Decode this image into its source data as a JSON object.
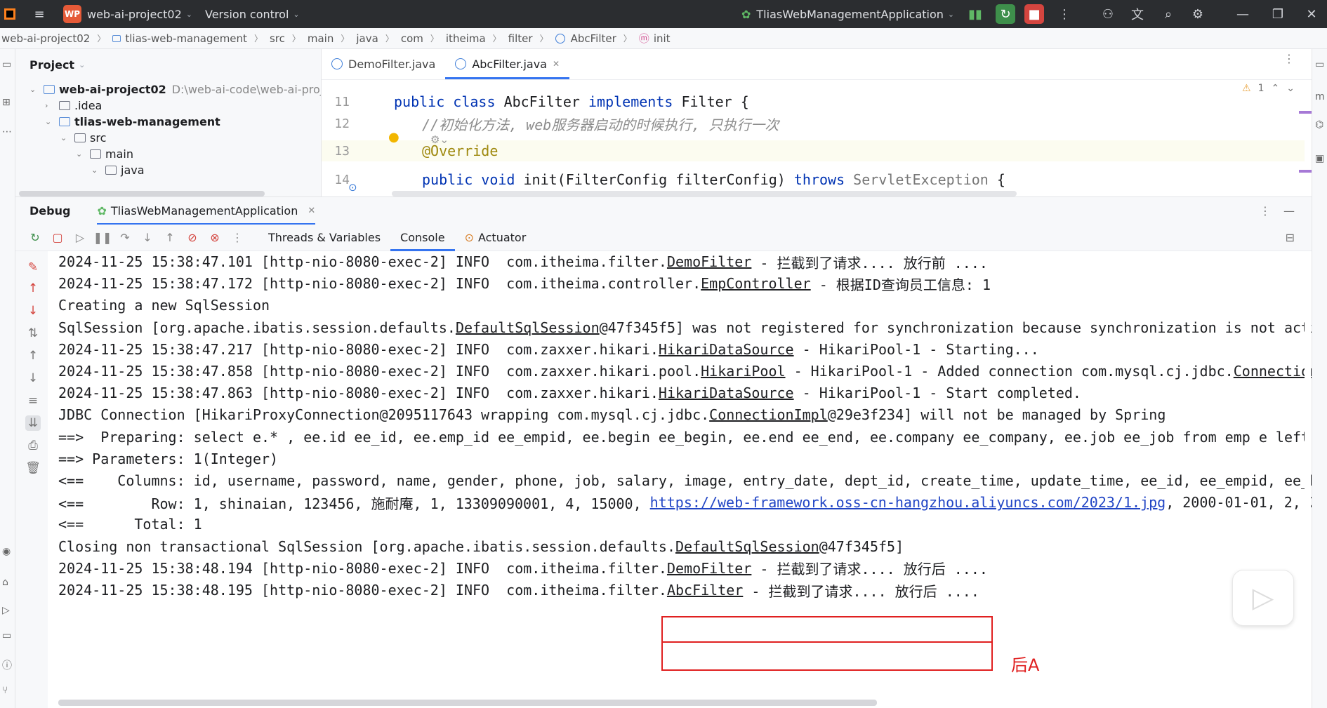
{
  "titlebar": {
    "project_badge": "WP",
    "project_name": "web-ai-project02",
    "version_control": "Version control",
    "run_config": "TliasWebManagementApplication"
  },
  "breadcrumbs": [
    "web-ai-project02",
    "tlias-web-management",
    "src",
    "main",
    "java",
    "com",
    "itheima",
    "filter",
    "AbcFilter",
    "init"
  ],
  "project_panel": {
    "title": "Project",
    "tree": [
      {
        "label": "web-ai-project02",
        "path": "D:\\web-ai-code\\web-ai-proj",
        "depth": 0,
        "expanded": true,
        "bold": true,
        "module": true
      },
      {
        "label": ".idea",
        "depth": 1,
        "expanded": false,
        "bold": false,
        "module": false
      },
      {
        "label": "tlias-web-management",
        "depth": 1,
        "expanded": true,
        "bold": true,
        "module": true
      },
      {
        "label": "src",
        "depth": 2,
        "expanded": true,
        "bold": false,
        "module": false
      },
      {
        "label": "main",
        "depth": 3,
        "expanded": true,
        "bold": false,
        "module": false
      },
      {
        "label": "java",
        "depth": 4,
        "expanded": true,
        "bold": false,
        "module": false
      }
    ]
  },
  "editor": {
    "tabs": [
      {
        "label": "DemoFilter.java",
        "active": false
      },
      {
        "label": "AbcFilter.java",
        "active": true
      }
    ],
    "warning_count": "1",
    "lines": [
      {
        "num": "11",
        "kind": "class_decl",
        "text": "public class AbcFilter implements Filter {"
      },
      {
        "num": "12",
        "kind": "comment",
        "text": "//初始化方法, web服务器启动的时候执行, 只执行一次"
      },
      {
        "num": "13",
        "kind": "annotation",
        "text": "@Override"
      },
      {
        "num": "14",
        "kind": "method_decl",
        "text": "public void init(FilterConfig filterConfig) throws ServletException {"
      }
    ]
  },
  "debug": {
    "title": "Debug",
    "session_tab": "TliasWebManagementApplication",
    "tabs": [
      {
        "label": "Threads & Variables",
        "active": false
      },
      {
        "label": "Console",
        "active": true
      },
      {
        "label": "Actuator",
        "active": false
      }
    ],
    "console_lines": [
      [
        {
          "t": "2024-11-25 15:38:47.101 [http-nio-8080-exec-2] INFO  com.itheima.filter."
        },
        {
          "t": "DemoFilter",
          "s": "u"
        },
        {
          "t": " - 拦截到了请求.... 放行前 ...."
        }
      ],
      [
        {
          "t": "2024-11-25 15:38:47.172 [http-nio-8080-exec-2] INFO  com.itheima.controller."
        },
        {
          "t": "EmpController",
          "s": "u"
        },
        {
          "t": " - 根据ID查询员工信息: 1"
        }
      ],
      [
        {
          "t": "Creating a new SqlSession"
        }
      ],
      [
        {
          "t": "SqlSession [org.apache.ibatis.session.defaults."
        },
        {
          "t": "DefaultSqlSession",
          "s": "u"
        },
        {
          "t": "@47f345f5] was not registered for synchronization because synchronization is not acti"
        }
      ],
      [
        {
          "t": "2024-11-25 15:38:47.217 [http-nio-8080-exec-2] INFO  com.zaxxer.hikari."
        },
        {
          "t": "HikariDataSource",
          "s": "u"
        },
        {
          "t": " - HikariPool-1 - Starting..."
        }
      ],
      [
        {
          "t": "2024-11-25 15:38:47.858 [http-nio-8080-exec-2] INFO  com.zaxxer.hikari.pool."
        },
        {
          "t": "HikariPool",
          "s": "u"
        },
        {
          "t": " - HikariPool-1 - Added connection com.mysql.cj.jdbc."
        },
        {
          "t": "Connection",
          "s": "u"
        }
      ],
      [
        {
          "t": "2024-11-25 15:38:47.863 [http-nio-8080-exec-2] INFO  com.zaxxer.hikari."
        },
        {
          "t": "HikariDataSource",
          "s": "u"
        },
        {
          "t": " - HikariPool-1 - Start completed."
        }
      ],
      [
        {
          "t": "JDBC Connection [HikariProxyConnection@2095117643 wrapping com.mysql.cj.jdbc."
        },
        {
          "t": "ConnectionImpl",
          "s": "u"
        },
        {
          "t": "@29e3f234] will not be managed by Spring"
        }
      ],
      [
        {
          "t": "==>  Preparing: select e.* , ee.id ee_id, ee.emp_id ee_empid, ee.begin ee_begin, ee.end ee_end, ee.company ee_company, ee.job ee_job from emp e left"
        }
      ],
      [
        {
          "t": "==> Parameters: 1(Integer)"
        }
      ],
      [
        {
          "t": "<==    Columns: id, username, password, name, gender, phone, job, salary, image, entry_date, dept_id, create_time, update_time, ee_id, ee_empid, ee_b"
        }
      ],
      [
        {
          "t": "<==        Row: 1, shinaian, 123456, 施耐庵, 1, 13309090001, 4, 15000, "
        },
        {
          "t": "https://web-framework.oss-cn-hangzhou.aliyuncs.com/2023/1.jpg",
          "s": "link"
        },
        {
          "t": ", 2000-01-01, 2, 2"
        }
      ],
      [
        {
          "t": "<==      Total: 1"
        }
      ],
      [
        {
          "t": "Closing non transactional SqlSession [org.apache.ibatis.session.defaults."
        },
        {
          "t": "DefaultSqlSession",
          "s": "u"
        },
        {
          "t": "@47f345f5]"
        }
      ],
      [
        {
          "t": "2024-11-25 15:38:48.194 [http-nio-8080-exec-2] INFO  com.itheima.filter."
        },
        {
          "t": "DemoFilter",
          "s": "u"
        },
        {
          "t": " - 拦截到了请求.... 放行后 ...."
        }
      ],
      [
        {
          "t": "2024-11-25 15:38:48.195 [http-nio-8080-exec-2] INFO  com.itheima.filter."
        },
        {
          "t": "AbcFilter",
          "s": "u"
        },
        {
          "t": " - 拦截到了请求.... 放行后 ...."
        }
      ]
    ],
    "annotation_note": "后A"
  },
  "colors": {
    "titlebar_bg": "#2b2d30",
    "accent": "#3574f0",
    "highlight_box": "#e02020",
    "keyword": "#0033b3",
    "link": "#2145c5"
  },
  "icons": [
    "menu-icon",
    "branch-icon",
    "debug-icon",
    "stop-icon",
    "more-icon",
    "user-icon",
    "translate-icon",
    "search-icon",
    "gear-icon",
    "minimize-icon",
    "maximize-icon",
    "close-icon"
  ]
}
